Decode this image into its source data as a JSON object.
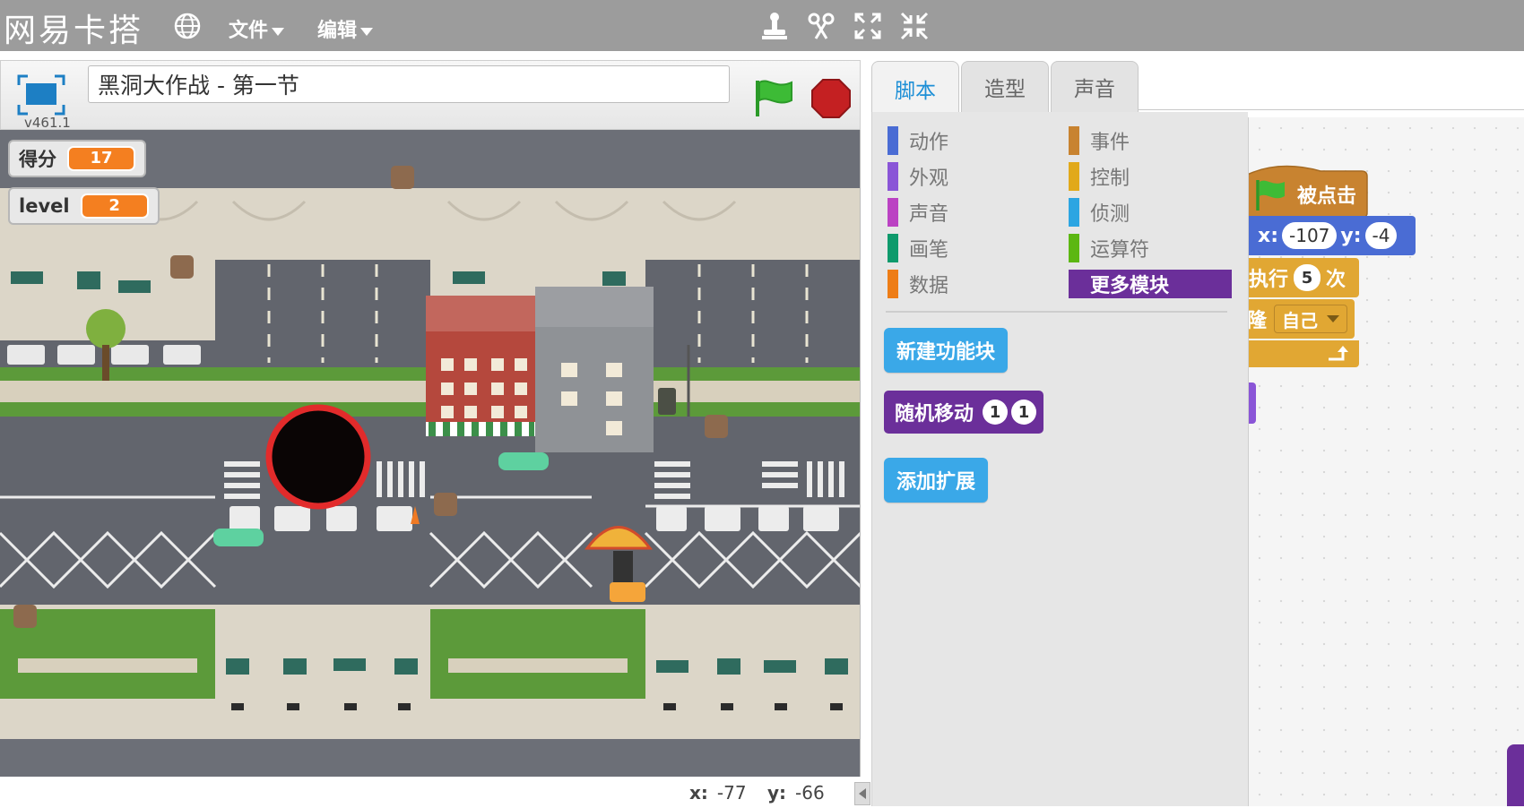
{
  "app": {
    "logo": "网易卡搭",
    "menu": {
      "file": "文件",
      "edit": "编辑"
    },
    "tool_icons": [
      "stamp-icon",
      "cut-icon",
      "grow-icon",
      "shrink-icon"
    ]
  },
  "stage": {
    "version": "v461.1",
    "project_title": "黑洞大作战 - 第一节",
    "monitors": [
      {
        "label": "得分",
        "value": "17"
      },
      {
        "label": "level",
        "value": "2"
      }
    ],
    "mouse_x_label": "x:",
    "mouse_x": "-77",
    "mouse_y_label": "y:",
    "mouse_y": "-66"
  },
  "tabs": [
    {
      "label": "脚本",
      "active": true
    },
    {
      "label": "造型",
      "active": false
    },
    {
      "label": "声音",
      "active": false
    }
  ],
  "palette": {
    "categories": [
      {
        "label": "动作",
        "color": "#4a6cd4"
      },
      {
        "label": "外观",
        "color": "#8a55d7"
      },
      {
        "label": "声音",
        "color": "#bb42c3"
      },
      {
        "label": "画笔",
        "color": "#0e9a6c"
      },
      {
        "label": "数据",
        "color": "#ee7d16"
      },
      {
        "label": "事件",
        "color": "#c88330"
      },
      {
        "label": "控制",
        "color": "#e1a91a"
      },
      {
        "label": "侦测",
        "color": "#2ca5e2"
      },
      {
        "label": "运算符",
        "color": "#5cb712"
      },
      {
        "label": "更多模块",
        "color": "#6b2f9a",
        "selected": true
      }
    ],
    "new_block_button": "新建功能块",
    "custom_block": {
      "label": "随机移动",
      "arg1": "1",
      "arg2": "1"
    },
    "add_extension_button": "添加扩展"
  },
  "scripts": {
    "hat_block": "被点击",
    "goto_x_label": "x:",
    "goto_x": "-107",
    "goto_y_label": "y:",
    "goto_y": "-4",
    "repeat_prefix": "执行",
    "repeat_count": "5",
    "repeat_suffix": "次",
    "clone_prefix": "隆",
    "clone_target": "自己"
  },
  "colors": {
    "menubar": "#9c9c9c",
    "accent": "#1d8fd6",
    "score": "#f47f20",
    "events": "#c88330",
    "control": "#e1a733",
    "motion": "#4a6cd4",
    "more": "#6b2f9a"
  }
}
